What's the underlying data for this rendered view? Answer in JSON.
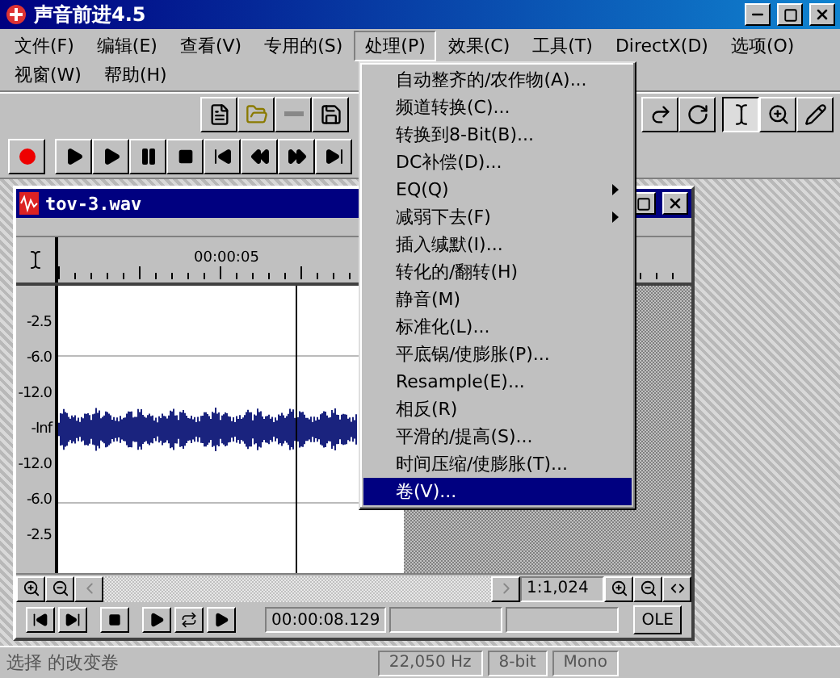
{
  "window": {
    "title": "声音前进4.5"
  },
  "menu_bar": {
    "rows": [
      [
        {
          "label": "文件(F)",
          "selected": false
        },
        {
          "label": "编辑(E)",
          "selected": false
        },
        {
          "label": "查看(V)",
          "selected": false
        },
        {
          "label": "专用的(S)",
          "selected": false
        },
        {
          "label": "处理(P)",
          "selected": true
        },
        {
          "label": "效果(C)",
          "selected": false
        },
        {
          "label": "工具(T)",
          "selected": false
        },
        {
          "label": "DirectX(D)",
          "selected": false
        },
        {
          "label": "选项(O)",
          "selected": false
        }
      ],
      [
        {
          "label": "视窗(W)",
          "selected": false
        },
        {
          "label": "帮助(H)",
          "selected": false
        }
      ]
    ]
  },
  "process_menu": {
    "items": [
      {
        "label": "自动整齐的/农作物(A)...",
        "submenu": false,
        "selected": false
      },
      {
        "label": "频道转换(C)...",
        "submenu": false,
        "selected": false
      },
      {
        "label": "转换到8-Bit(B)...",
        "submenu": false,
        "selected": false
      },
      {
        "label": "DC补偿(D)...",
        "submenu": false,
        "selected": false
      },
      {
        "label": "EQ(Q)",
        "submenu": true,
        "selected": false
      },
      {
        "label": "减弱下去(F)",
        "submenu": true,
        "selected": false
      },
      {
        "label": "插入缄默(I)...",
        "submenu": false,
        "selected": false
      },
      {
        "label": "转化的/翻转(H)",
        "submenu": false,
        "selected": false
      },
      {
        "label": "静音(M)",
        "submenu": false,
        "selected": false
      },
      {
        "label": "标准化(L)...",
        "submenu": false,
        "selected": false
      },
      {
        "label": "平底锅/使膨胀(P)...",
        "submenu": false,
        "selected": false
      },
      {
        "label": "Resample(E)...",
        "submenu": false,
        "selected": false
      },
      {
        "label": "相反(R)",
        "submenu": false,
        "selected": false
      },
      {
        "label": "平滑的/提高(S)...",
        "submenu": false,
        "selected": false
      },
      {
        "label": "时间压缩/使膨胀(T)...",
        "submenu": false,
        "selected": false
      },
      {
        "label": "卷(V)...",
        "submenu": false,
        "selected": true
      }
    ]
  },
  "document": {
    "title": "tov-3.wav",
    "ruler_label": "00:00:05",
    "db_labels": [
      "-2.5",
      "-6.0",
      "-12.0",
      "-Inf",
      "-12.0",
      "-6.0",
      "-2.5"
    ],
    "zoom_ratio": "1:1,024",
    "time": "00:00:08.129",
    "ole_button": "OLE"
  },
  "status_bar": {
    "message": "选择 的改变卷",
    "fields": [
      "22,050 Hz",
      "8-bit",
      "Mono"
    ]
  }
}
